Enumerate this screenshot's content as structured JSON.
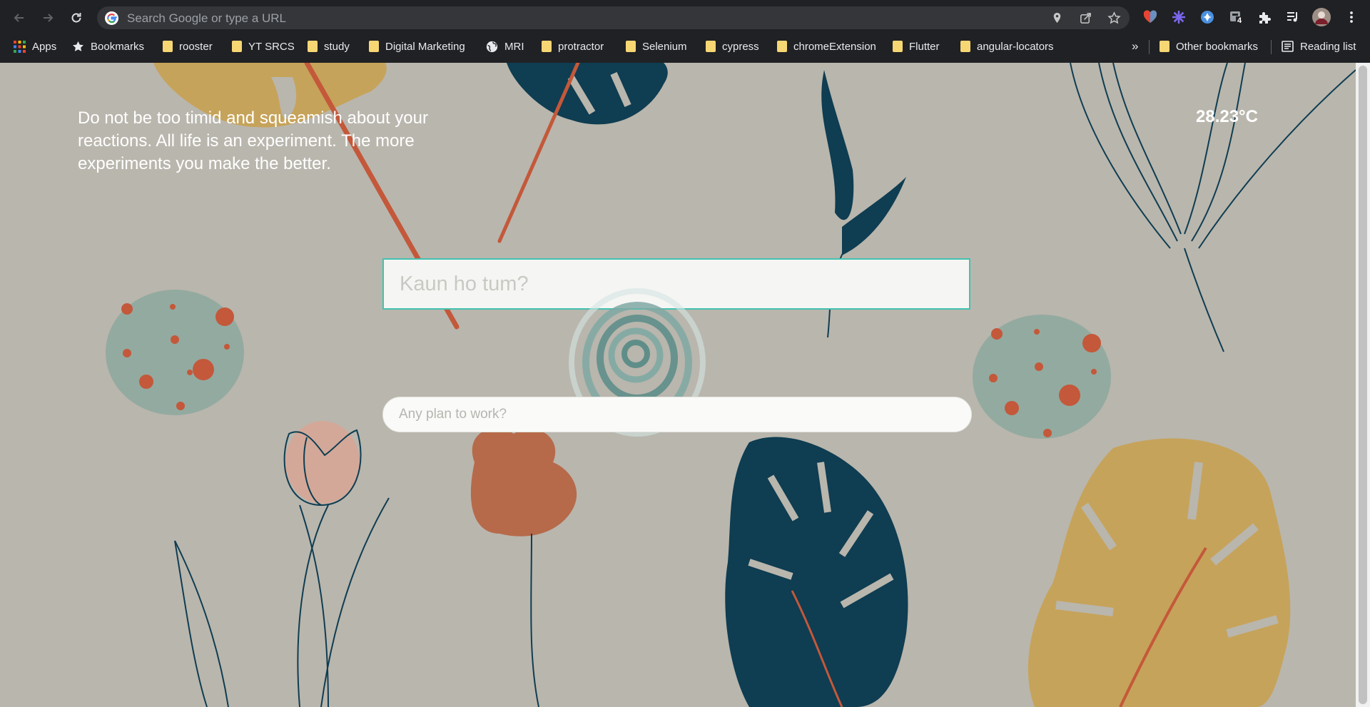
{
  "browser": {
    "omnibox_placeholder": "Search Google or type a URL",
    "extension_badge": "4",
    "bookmarks": [
      {
        "label": "Apps",
        "icon": "apps-grid-icon"
      },
      {
        "label": "Bookmarks",
        "icon": "star-icon"
      },
      {
        "label": "rooster",
        "icon": "folder-icon"
      },
      {
        "label": "YT SRCS",
        "icon": "folder-icon"
      },
      {
        "label": "study",
        "icon": "folder-icon"
      },
      {
        "label": "Digital Marketing",
        "icon": "folder-icon"
      },
      {
        "label": "MRI",
        "icon": "globe-icon"
      },
      {
        "label": "protractor",
        "icon": "folder-icon"
      },
      {
        "label": "Selenium",
        "icon": "folder-icon"
      },
      {
        "label": "cypress",
        "icon": "folder-icon"
      },
      {
        "label": "chromeExtension",
        "icon": "folder-icon"
      },
      {
        "label": "Flutter",
        "icon": "folder-icon"
      },
      {
        "label": "angular-locators",
        "icon": "folder-icon"
      }
    ],
    "overflow_label": "»",
    "other_bookmarks": "Other bookmarks",
    "reading_list": "Reading list"
  },
  "page": {
    "quote": "Do not be too timid and squeamish about your reactions. All life is an experiment. The more experiments you make the better.",
    "weather": "28.23°C",
    "name_placeholder": "Kaun ho tum?",
    "plan_placeholder": "Any plan to work?"
  },
  "colors": {
    "background": "#b9b6ad",
    "teal_leaf": "#0f3d52",
    "mustard_leaf": "#c6a35a",
    "rust": "#c4583a",
    "egg": "#93aaa0",
    "accent_border": "#43c2b0"
  }
}
